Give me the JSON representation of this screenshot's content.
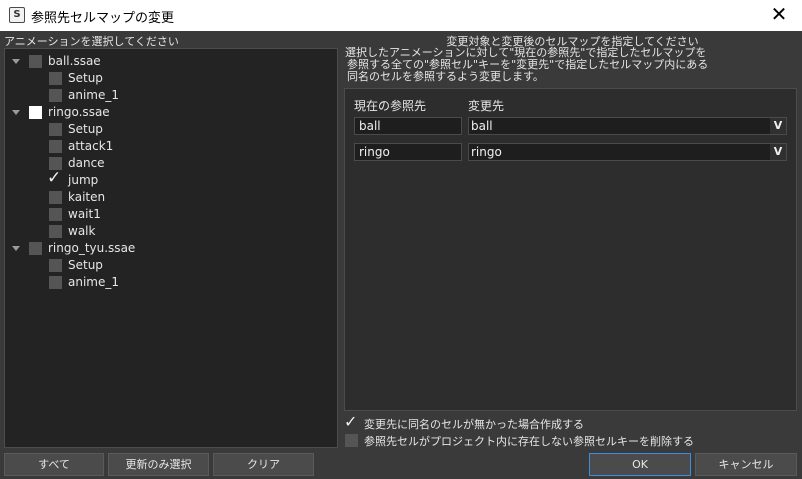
{
  "window": {
    "title": "参照先セルマップの変更",
    "close_glyph": "✕",
    "icon_text": "S"
  },
  "left": {
    "header": "アニメーションを選択してください",
    "files": [
      {
        "name": "ball.ssae",
        "checked": false,
        "anims": [
          {
            "name": "Setup",
            "checked": false
          },
          {
            "name": "anime_1",
            "checked": false
          }
        ]
      },
      {
        "name": "ringo.ssae",
        "checked": "partial",
        "anims": [
          {
            "name": "Setup",
            "checked": false
          },
          {
            "name": "attack1",
            "checked": false
          },
          {
            "name": "dance",
            "checked": false
          },
          {
            "name": "jump",
            "checked": true
          },
          {
            "name": "kaiten",
            "checked": false
          },
          {
            "name": "wait1",
            "checked": false
          },
          {
            "name": "walk",
            "checked": false
          }
        ]
      },
      {
        "name": "ringo_tyu.ssae",
        "checked": false,
        "anims": [
          {
            "name": "Setup",
            "checked": false
          },
          {
            "name": "anime_1",
            "checked": false
          }
        ]
      }
    ]
  },
  "right": {
    "header": "変更対象と変更後のセルマップを指定してください",
    "description": [
      "選択したアニメーションに対して\"現在の参照先\"で指定したセルマップを",
      "参照する全ての\"参照セル\"キーを\"変更先\"で指定したセルマップ内にある",
      "同名のセルを参照するよう変更します。"
    ],
    "col_current": "現在の参照先",
    "col_target": "変更先",
    "mappings": [
      {
        "current": "ball",
        "target": "ball"
      },
      {
        "current": "ringo",
        "target": "ringo"
      }
    ],
    "dropdown_glyph": "V",
    "options": [
      {
        "label": "変更先に同名のセルが無かった場合作成する",
        "checked": true
      },
      {
        "label": "参照先セルがプロジェクト内に存在しない参照セルキーを削除する",
        "checked": false
      }
    ]
  },
  "buttons": {
    "all": "すべて",
    "updated_only": "更新のみ選択",
    "clear": "クリア",
    "ok": "OK",
    "cancel": "キャンセル"
  },
  "colors": {
    "background": "#3a3a3a",
    "panel": "#232323",
    "accent": "#3b8fe0"
  }
}
